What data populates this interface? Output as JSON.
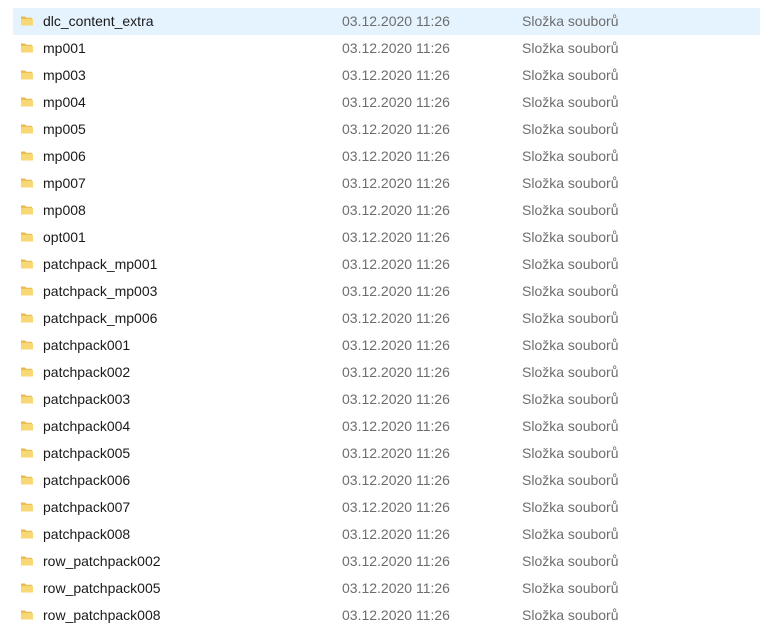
{
  "colors": {
    "selected_row": "#e5f3ff",
    "folder_front": "#f8d775",
    "folder_back": "#e8b94a",
    "secondary_text": "#6d6d6d"
  },
  "rows": [
    {
      "name": "dlc_content_extra",
      "date": "03.12.2020 11:26",
      "type": "Složka souborů",
      "icon": "folder-icon",
      "selected": true
    },
    {
      "name": "mp001",
      "date": "03.12.2020 11:26",
      "type": "Složka souborů",
      "icon": "folder-icon"
    },
    {
      "name": "mp003",
      "date": "03.12.2020 11:26",
      "type": "Složka souborů",
      "icon": "folder-icon"
    },
    {
      "name": "mp004",
      "date": "03.12.2020 11:26",
      "type": "Složka souborů",
      "icon": "folder-icon"
    },
    {
      "name": "mp005",
      "date": "03.12.2020 11:26",
      "type": "Složka souborů",
      "icon": "folder-icon"
    },
    {
      "name": "mp006",
      "date": "03.12.2020 11:26",
      "type": "Složka souborů",
      "icon": "folder-icon"
    },
    {
      "name": "mp007",
      "date": "03.12.2020 11:26",
      "type": "Složka souborů",
      "icon": "folder-icon"
    },
    {
      "name": "mp008",
      "date": "03.12.2020 11:26",
      "type": "Složka souborů",
      "icon": "folder-icon"
    },
    {
      "name": "opt001",
      "date": "03.12.2020 11:26",
      "type": "Složka souborů",
      "icon": "folder-icon"
    },
    {
      "name": "patchpack_mp001",
      "date": "03.12.2020 11:26",
      "type": "Složka souborů",
      "icon": "folder-icon"
    },
    {
      "name": "patchpack_mp003",
      "date": "03.12.2020 11:26",
      "type": "Složka souborů",
      "icon": "folder-icon"
    },
    {
      "name": "patchpack_mp006",
      "date": "03.12.2020 11:26",
      "type": "Složka souborů",
      "icon": "folder-icon"
    },
    {
      "name": "patchpack001",
      "date": "03.12.2020 11:26",
      "type": "Složka souborů",
      "icon": "folder-icon"
    },
    {
      "name": "patchpack002",
      "date": "03.12.2020 11:26",
      "type": "Složka souborů",
      "icon": "folder-icon"
    },
    {
      "name": "patchpack003",
      "date": "03.12.2020 11:26",
      "type": "Složka souborů",
      "icon": "folder-icon"
    },
    {
      "name": "patchpack004",
      "date": "03.12.2020 11:26",
      "type": "Složka souborů",
      "icon": "folder-icon"
    },
    {
      "name": "patchpack005",
      "date": "03.12.2020 11:26",
      "type": "Složka souborů",
      "icon": "folder-icon"
    },
    {
      "name": "patchpack006",
      "date": "03.12.2020 11:26",
      "type": "Složka souborů",
      "icon": "folder-icon"
    },
    {
      "name": "patchpack007",
      "date": "03.12.2020 11:26",
      "type": "Složka souborů",
      "icon": "folder-icon"
    },
    {
      "name": "patchpack008",
      "date": "03.12.2020 11:26",
      "type": "Složka souborů",
      "icon": "folder-icon"
    },
    {
      "name": "row_patchpack002",
      "date": "03.12.2020 11:26",
      "type": "Složka souborů",
      "icon": "folder-icon"
    },
    {
      "name": "row_patchpack005",
      "date": "03.12.2020 11:26",
      "type": "Složka souborů",
      "icon": "folder-icon"
    },
    {
      "name": "row_patchpack008",
      "date": "03.12.2020 11:26",
      "type": "Složka souborů",
      "icon": "folder-icon"
    }
  ]
}
